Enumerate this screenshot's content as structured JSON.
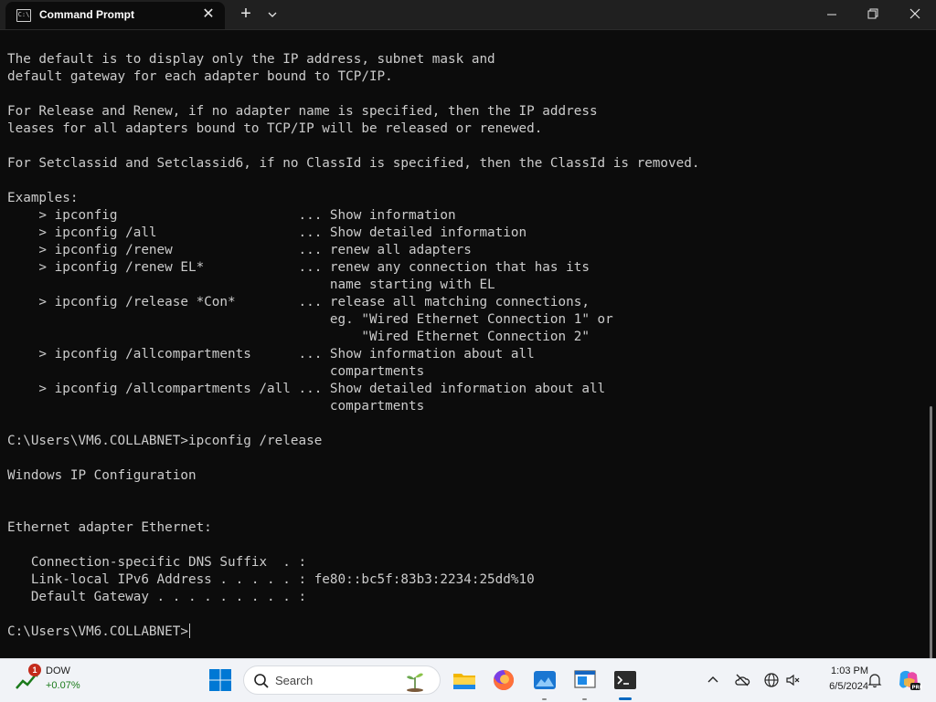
{
  "window": {
    "tab_title": "Command Prompt",
    "tab_icon_text": "C:\\"
  },
  "console": {
    "lines": [
      "The default is to display only the IP address, subnet mask and",
      "default gateway for each adapter bound to TCP/IP.",
      "",
      "For Release and Renew, if no adapter name is specified, then the IP address",
      "leases for all adapters bound to TCP/IP will be released or renewed.",
      "",
      "For Setclassid and Setclassid6, if no ClassId is specified, then the ClassId is removed.",
      "",
      "Examples:",
      "    > ipconfig                       ... Show information",
      "    > ipconfig /all                  ... Show detailed information",
      "    > ipconfig /renew                ... renew all adapters",
      "    > ipconfig /renew EL*            ... renew any connection that has its",
      "                                         name starting with EL",
      "    > ipconfig /release *Con*        ... release all matching connections,",
      "                                         eg. \"Wired Ethernet Connection 1\" or",
      "                                             \"Wired Ethernet Connection 2\"",
      "    > ipconfig /allcompartments      ... Show information about all",
      "                                         compartments",
      "    > ipconfig /allcompartments /all ... Show detailed information about all",
      "                                         compartments",
      "",
      "C:\\Users\\VM6.COLLABNET>ipconfig /release",
      "",
      "Windows IP Configuration",
      "",
      "",
      "Ethernet adapter Ethernet:",
      "",
      "   Connection-specific DNS Suffix  . :",
      "   Link-local IPv6 Address . . . . . : fe80::bc5f:83b3:2234:25dd%10",
      "   Default Gateway . . . . . . . . . :",
      ""
    ],
    "prompt": "C:\\Users\\VM6.COLLABNET>"
  },
  "taskbar": {
    "stock_name": "DOW",
    "stock_change": "+0.07%",
    "stock_badge": "1",
    "search_label": "Search",
    "time": "1:03 PM",
    "date": "6/5/2024"
  },
  "colors": {
    "console_bg": "#0c0c0c",
    "console_text": "#cccccc",
    "titlebar_bg": "#202020",
    "taskbar_bg": "#f1f3f7",
    "accent": "#0067c0"
  }
}
